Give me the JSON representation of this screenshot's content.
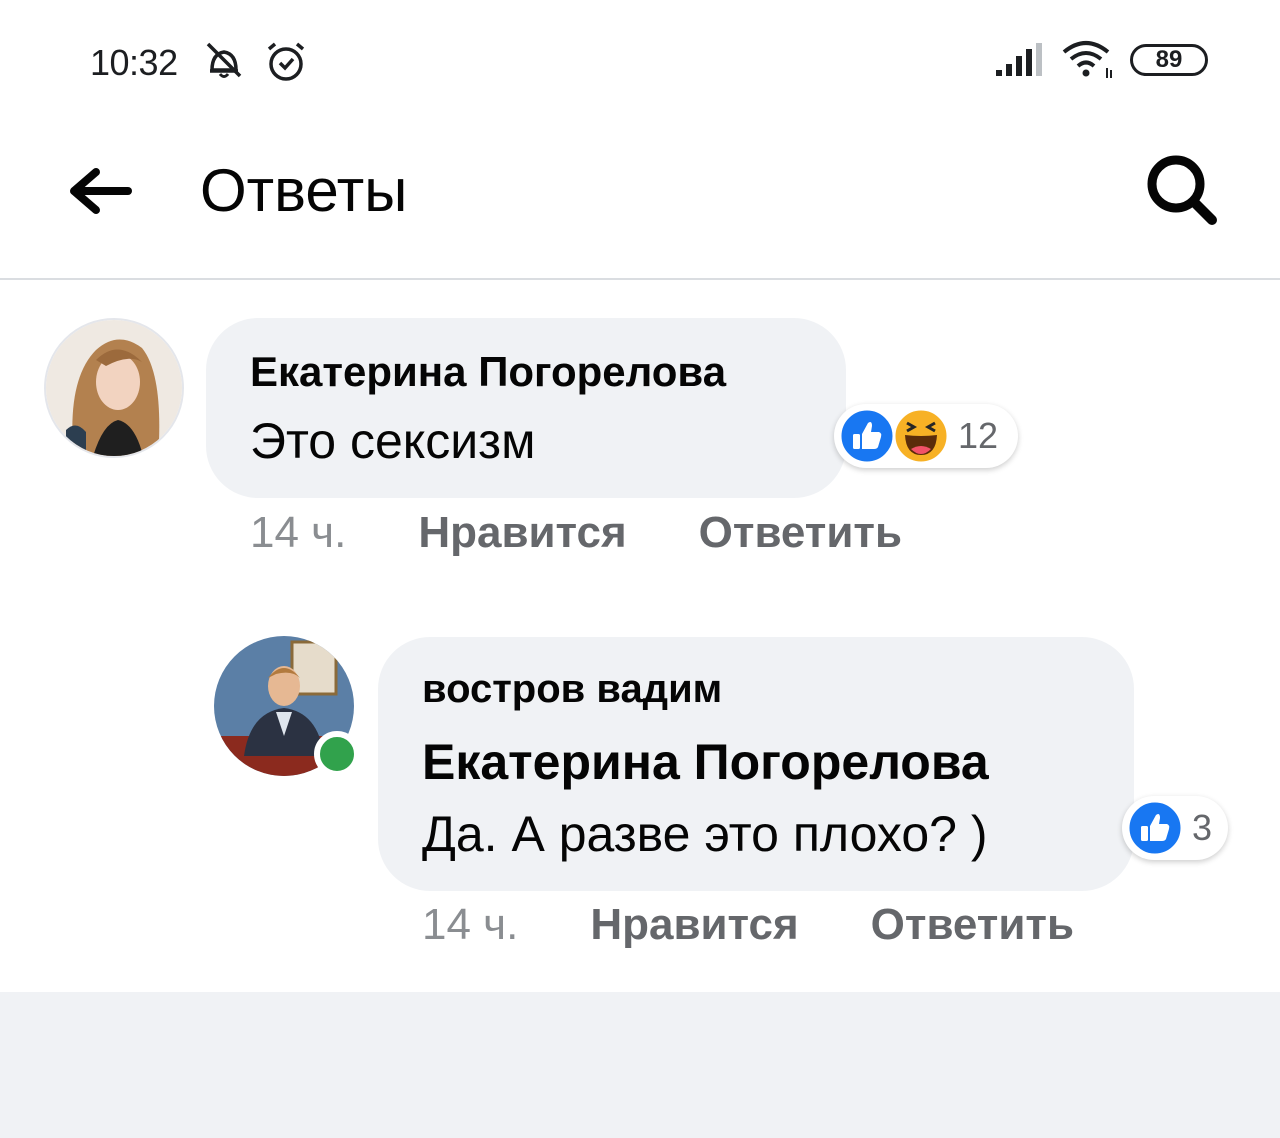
{
  "status_bar": {
    "time": "10:32",
    "battery": "89",
    "icons": [
      "bell-off-icon",
      "alarm-icon",
      "signal-icon",
      "wifi-icon",
      "battery-icon"
    ]
  },
  "header": {
    "title": "Ответы",
    "back_icon": "arrow-left-icon",
    "search_icon": "search-icon"
  },
  "comments": [
    {
      "author": "Екатерина Погорелова",
      "text": "Это сексизм",
      "reactions": {
        "types": [
          "like",
          "haha"
        ],
        "count": "12"
      },
      "actions": {
        "time": "14 ч.",
        "like": "Нравится",
        "reply": "Ответить"
      }
    },
    {
      "author": "востров вадим",
      "mention": "Екатерина Погорелова",
      "text": "Да. А разве это плохо? )",
      "online": true,
      "reactions": {
        "types": [
          "like"
        ],
        "count": "3"
      },
      "actions": {
        "time": "14 ч.",
        "like": "Нравится",
        "reply": "Ответить"
      }
    }
  ],
  "colors": {
    "bubble": "#f0f2f5",
    "secondary_text": "#65676b",
    "like_blue": "#1877f2",
    "haha_yellow": "#f7b125",
    "online_green": "#31a24c"
  }
}
